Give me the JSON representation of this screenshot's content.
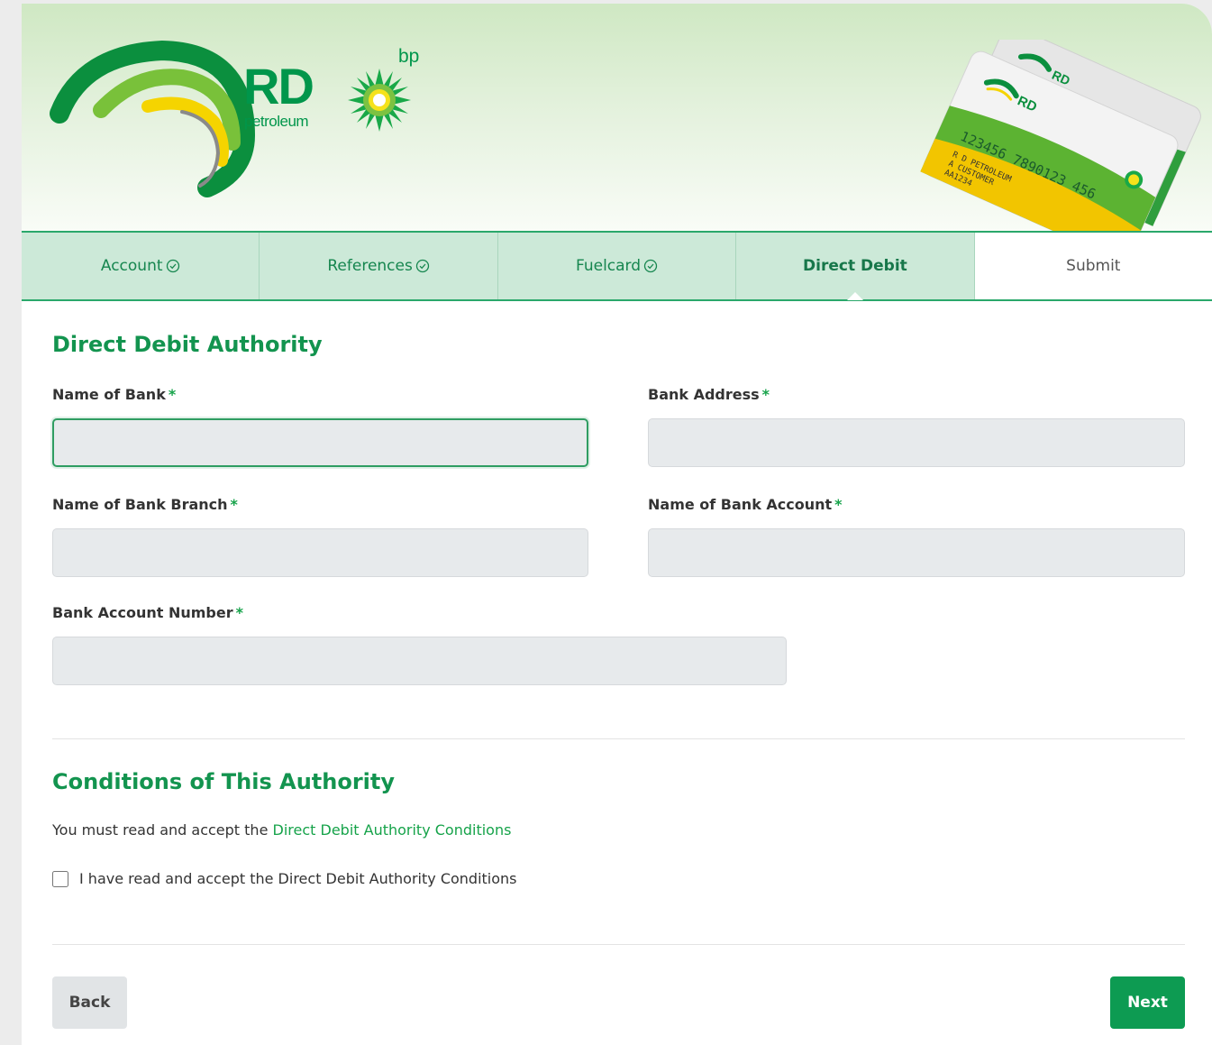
{
  "brand": {
    "logo_main": "RD",
    "logo_sub": "petroleum",
    "partner": "bp",
    "colors": {
      "primary": "#0d9b52",
      "accent": "#16a34a",
      "yellow": "#f5d400"
    }
  },
  "card_image": {
    "number": "123456 7890123 456",
    "line1": "R D PETROLEUM",
    "line2": "A CUSTOMER",
    "line3": "AA1234"
  },
  "steps": [
    {
      "label": "Account",
      "state": "complete",
      "icon": "check-circle-icon"
    },
    {
      "label": "References",
      "state": "complete",
      "icon": "check-circle-icon"
    },
    {
      "label": "Fuelcard",
      "state": "complete",
      "icon": "check-circle-icon"
    },
    {
      "label": "Direct Debit",
      "state": "active"
    },
    {
      "label": "Submit",
      "state": "pending"
    }
  ],
  "form": {
    "title": "Direct Debit Authority",
    "required_marker": "*",
    "fields": {
      "bank_name": {
        "label": "Name of Bank",
        "value": ""
      },
      "bank_address": {
        "label": "Bank Address",
        "value": ""
      },
      "bank_branch": {
        "label": "Name of Bank Branch",
        "value": ""
      },
      "bank_account_name": {
        "label": "Name of Bank Account",
        "value": ""
      },
      "bank_account_number": {
        "label": "Bank Account Number",
        "value": ""
      }
    }
  },
  "conditions": {
    "title": "Conditions of This Authority",
    "intro": "You must read and accept the ",
    "link": "Direct Debit Authority Conditions",
    "checkbox_label": "I have read and accept the Direct Debit Authority Conditions",
    "checked": false
  },
  "buttons": {
    "back": "Back",
    "next": "Next"
  }
}
